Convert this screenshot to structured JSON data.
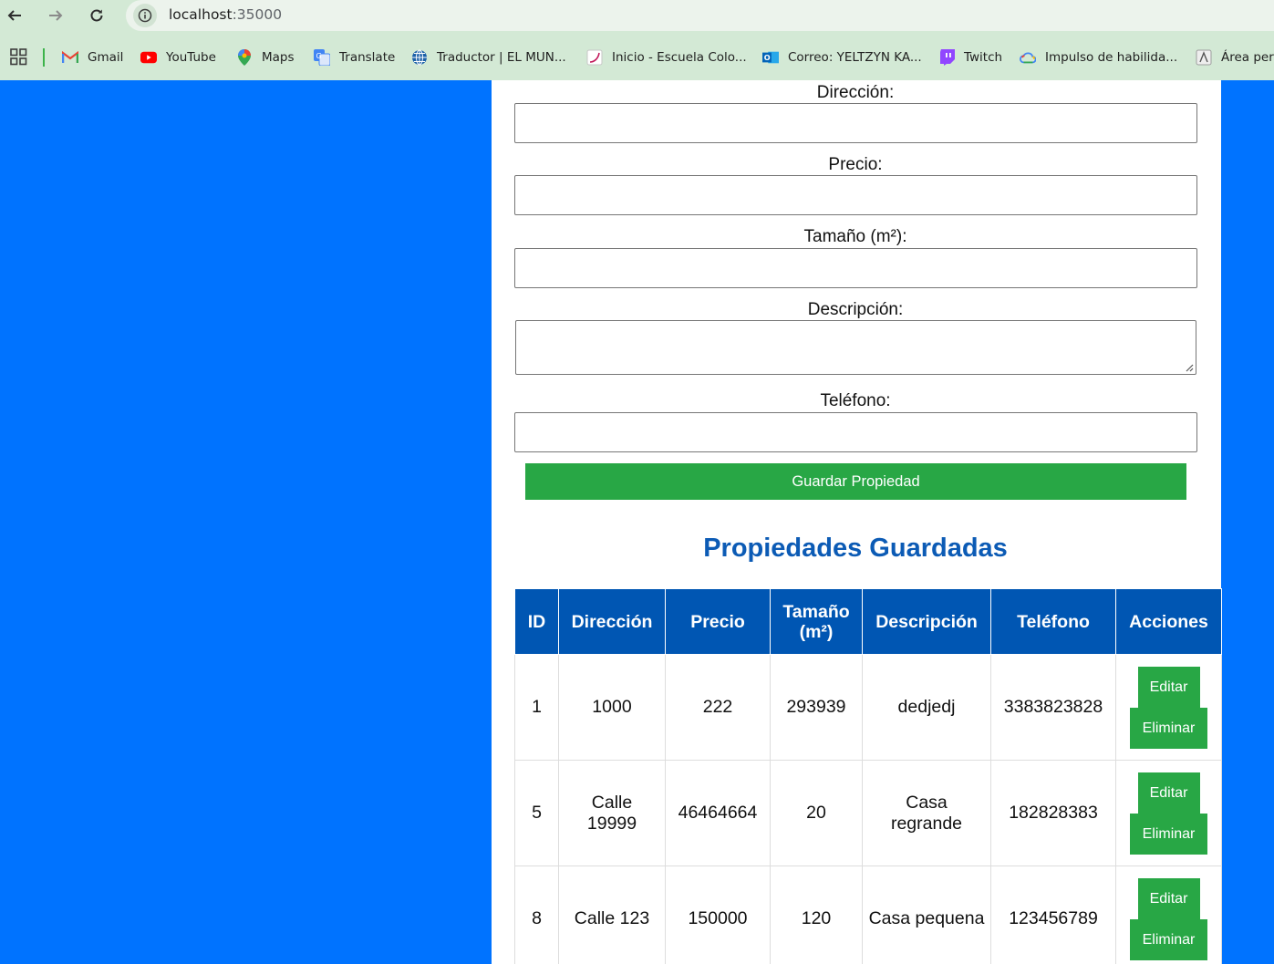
{
  "browser": {
    "url_host": "localhost",
    "url_port": ":35000",
    "bookmarks": [
      {
        "label": "Gmail",
        "icon": "gmail-icon"
      },
      {
        "label": "YouTube",
        "icon": "youtube-icon"
      },
      {
        "label": "Maps",
        "icon": "maps-icon"
      },
      {
        "label": "Translate",
        "icon": "translate-icon"
      },
      {
        "label": "Traductor | EL MUN...",
        "icon": "globe-icon"
      },
      {
        "label": "Inicio - Escuela Colo...",
        "icon": "school-icon"
      },
      {
        "label": "Correo: YELTZYN KA...",
        "icon": "outlook-icon"
      },
      {
        "label": "Twitch",
        "icon": "twitch-icon"
      },
      {
        "label": "Impulso de habilida...",
        "icon": "cloud-icon"
      },
      {
        "label": "Área pers",
        "icon": "area-icon"
      }
    ]
  },
  "form": {
    "direccion_label": "Dirección:",
    "precio_label": "Precio:",
    "tamano_label": "Tamaño (m²):",
    "descripcion_label": "Descripción:",
    "telefono_label": "Teléfono:",
    "save_label": "Guardar Propiedad"
  },
  "table": {
    "title": "Propiedades Guardadas",
    "headers": [
      "ID",
      "Dirección",
      "Precio",
      "Tamaño (m²)",
      "Descripción",
      "Teléfono",
      "Acciones"
    ],
    "rows": [
      {
        "id": "1",
        "direccion": "1000",
        "precio": "222",
        "tamano": "293939",
        "descripcion": "dedjedj",
        "telefono": "3383823828"
      },
      {
        "id": "5",
        "direccion": "Calle 19999",
        "precio": "46464664",
        "tamano": "20",
        "descripcion": "Casa regrande",
        "telefono": "182828383"
      },
      {
        "id": "8",
        "direccion": "Calle 123",
        "precio": "150000",
        "tamano": "120",
        "descripcion": "Casa pequena",
        "telefono": "123456789"
      }
    ],
    "edit_label": "Editar",
    "delete_label": "Eliminar"
  },
  "colors": {
    "page_background": "#0073ff",
    "header_blue": "#0056b3",
    "button_green": "#28a745",
    "title_blue": "#0c5bb5"
  }
}
